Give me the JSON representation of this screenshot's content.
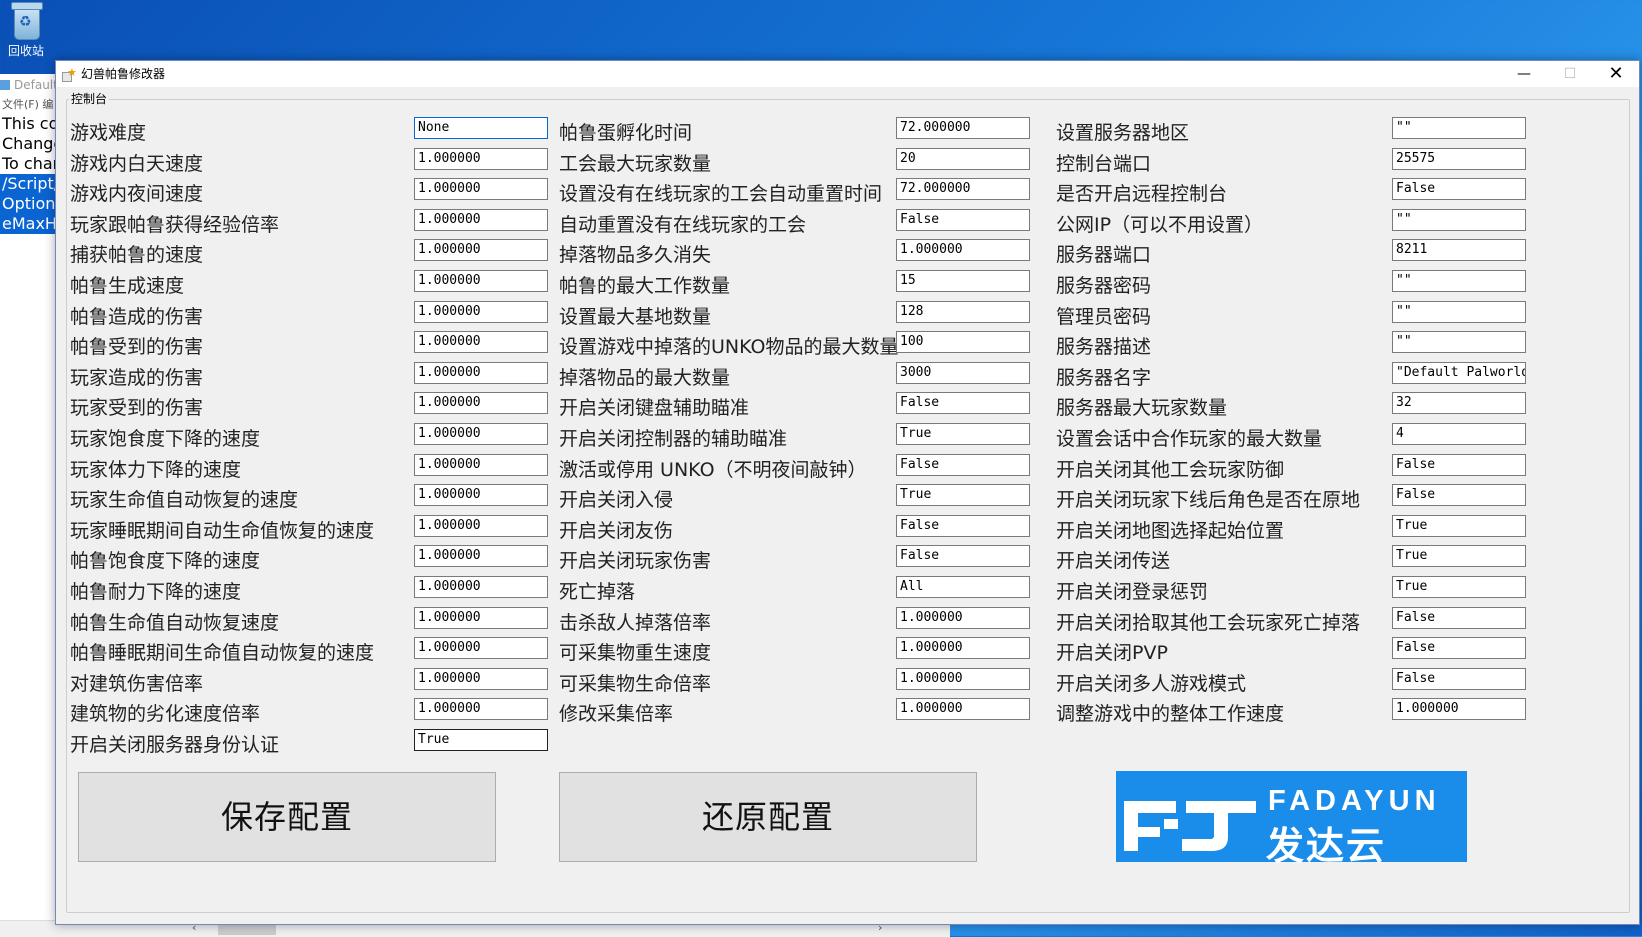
{
  "desktop": {
    "recycle_bin_label": "回收站"
  },
  "background_window": {
    "title": "Default",
    "menu": "文件(F)  编",
    "lines": [
      "This cor",
      "Change",
      "To char",
      "/Script/I",
      "OptionSe",
      "eMaxHo"
    ]
  },
  "window": {
    "title": "幻兽帕鲁修改器",
    "minimize_glyph": "—",
    "maximize_glyph": "☐",
    "close_glyph": "✕",
    "group_label": "控制台"
  },
  "col1": [
    {
      "label": "游戏难度",
      "value": "None"
    },
    {
      "label": "游戏内白天速度",
      "value": "1.000000"
    },
    {
      "label": "游戏内夜间速度",
      "value": "1.000000"
    },
    {
      "label": "玩家跟帕鲁获得经验倍率",
      "value": "1.000000"
    },
    {
      "label": "捕获帕鲁的速度",
      "value": "1.000000"
    },
    {
      "label": "帕鲁生成速度",
      "value": "1.000000"
    },
    {
      "label": "帕鲁造成的伤害",
      "value": "1.000000"
    },
    {
      "label": "帕鲁受到的伤害",
      "value": "1.000000"
    },
    {
      "label": "玩家造成的伤害",
      "value": "1.000000"
    },
    {
      "label": "玩家受到的伤害",
      "value": "1.000000"
    },
    {
      "label": "玩家饱食度下降的速度",
      "value": "1.000000"
    },
    {
      "label": "玩家体力下降的速度",
      "value": "1.000000"
    },
    {
      "label": "玩家生命值自动恢复的速度",
      "value": "1.000000"
    },
    {
      "label": "玩家睡眠期间自动生命值恢复的速度",
      "value": "1.000000"
    },
    {
      "label": "帕鲁饱食度下降的速度",
      "value": "1.000000"
    },
    {
      "label": "帕鲁耐力下降的速度",
      "value": "1.000000"
    },
    {
      "label": "帕鲁生命值自动恢复速度",
      "value": "1.000000"
    },
    {
      "label": "帕鲁睡眠期间生命值自动恢复的速度",
      "value": "1.000000"
    },
    {
      "label": "对建筑伤害倍率",
      "value": "1.000000"
    },
    {
      "label": "建筑物的劣化速度倍率",
      "value": "1.000000"
    },
    {
      "label": "开启关闭服务器身份认证",
      "value": "True"
    }
  ],
  "col2": [
    {
      "label": "帕鲁蛋孵化时间",
      "value": "72.000000"
    },
    {
      "label": "工会最大玩家数量",
      "value": "20"
    },
    {
      "label": "设置没有在线玩家的工会自动重置时间",
      "value": "72.000000"
    },
    {
      "label": "自动重置没有在线玩家的工会",
      "value": "False"
    },
    {
      "label": "掉落物品多久消失",
      "value": "1.000000"
    },
    {
      "label": "帕鲁的最大工作数量",
      "value": "15"
    },
    {
      "label": "设置最大基地数量",
      "value": "128"
    },
    {
      "label": "设置游戏中掉落的UNKO物品的最大数量",
      "value": "100"
    },
    {
      "label": "掉落物品的最大数量",
      "value": "3000"
    },
    {
      "label": "开启关闭键盘辅助瞄准",
      "value": "False"
    },
    {
      "label": "开启关闭控制器的辅助瞄准",
      "value": "True"
    },
    {
      "label": "激活或停用 UNKO（不明夜间敲钟）",
      "value": "False"
    },
    {
      "label": "开启关闭入侵",
      "value": "True"
    },
    {
      "label": "开启关闭友伤",
      "value": "False"
    },
    {
      "label": "开启关闭玩家伤害",
      "value": "False"
    },
    {
      "label": "死亡掉落",
      "value": "All"
    },
    {
      "label": "击杀敌人掉落倍率",
      "value": "1.000000"
    },
    {
      "label": "可采集物重生速度",
      "value": "1.000000"
    },
    {
      "label": "可采集物生命倍率",
      "value": "1.000000"
    },
    {
      "label": "修改采集倍率",
      "value": "1.000000"
    }
  ],
  "col3": [
    {
      "label": "设置服务器地区",
      "value": "\"\""
    },
    {
      "label": "控制台端口",
      "value": "25575"
    },
    {
      "label": "是否开启远程控制台",
      "value": "False"
    },
    {
      "label": "公网IP（可以不用设置）",
      "value": "\"\""
    },
    {
      "label": "服务器端口",
      "value": "8211"
    },
    {
      "label": "服务器密码",
      "value": "\"\""
    },
    {
      "label": "管理员密码",
      "value": "\"\""
    },
    {
      "label": "服务器描述",
      "value": "\"\""
    },
    {
      "label": "服务器名字",
      "value": "\"Default Palworld"
    },
    {
      "label": "服务器最大玩家数量",
      "value": "32"
    },
    {
      "label": "设置会话中合作玩家的最大数量",
      "value": "4"
    },
    {
      "label": "开启关闭其他工会玩家防御",
      "value": "False"
    },
    {
      "label": "开启关闭玩家下线后角色是否在原地",
      "value": "False"
    },
    {
      "label": "开启关闭地图选择起始位置",
      "value": "True"
    },
    {
      "label": "开启关闭传送",
      "value": "True"
    },
    {
      "label": "开启关闭登录惩罚",
      "value": "True"
    },
    {
      "label": "开启关闭拾取其他工会玩家死亡掉落",
      "value": "False"
    },
    {
      "label": "开启关闭PVP",
      "value": "False"
    },
    {
      "label": "开启关闭多人游戏模式",
      "value": "False"
    },
    {
      "label": "调整游戏中的整体工作速度",
      "value": "1.000000"
    }
  ],
  "buttons": {
    "save": "保存配置",
    "restore": "还原配置"
  },
  "logo": {
    "text_en": "FADAYUN",
    "text_cn": "发达云",
    "color": "#1a8cea"
  },
  "icons": {
    "recycle_bin": "recycle-bin-icon",
    "app": "app-icon"
  }
}
